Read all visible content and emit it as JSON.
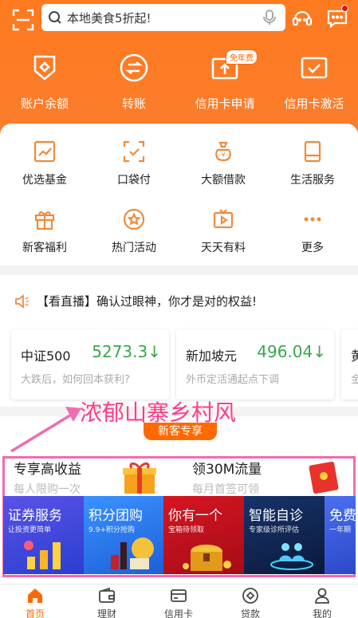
{
  "header": {
    "search_placeholder": "本地美食5折起!",
    "quick_actions": [
      {
        "label": "账户余额",
        "icon": "wallet-shield-icon"
      },
      {
        "label": "转账",
        "icon": "transfer-icon"
      },
      {
        "label": "信用卡申请",
        "icon": "credit-card-apply-icon",
        "badge": "免年费"
      },
      {
        "label": "信用卡激活",
        "icon": "credit-card-activate-icon"
      }
    ]
  },
  "services": [
    {
      "label": "优选基金",
      "icon": "fund-chart-icon"
    },
    {
      "label": "口袋付",
      "icon": "scan-pay-icon"
    },
    {
      "label": "大额借款",
      "icon": "money-bag-icon"
    },
    {
      "label": "生活服务",
      "icon": "tablet-icon"
    },
    {
      "label": "新客福利",
      "icon": "gift-icon"
    },
    {
      "label": "热门活动",
      "icon": "star-badge-icon"
    },
    {
      "label": "天天有料",
      "icon": "video-play-icon"
    },
    {
      "label": "更多",
      "icon": "more-dots-icon"
    }
  ],
  "news": {
    "headline": "【看直播】确认过眼神，你才是对的权益!"
  },
  "market_cards": [
    {
      "name": "中证500",
      "value": "5273.3↓",
      "sub": "大跌后，如何回本获利?"
    },
    {
      "name": "新加坡元",
      "value": "496.04↓",
      "sub": "外币定活通起点下调"
    },
    {
      "name": "黄",
      "value": "",
      "sub": "金"
    }
  ],
  "annotation": "浓郁山寨乡村风",
  "promo": {
    "tag": "新客专享",
    "left_title": "专享高收益",
    "left_sub": "每人限购一次",
    "right_title": "领30M流量",
    "right_sub": "每月首签可领"
  },
  "tiles": [
    {
      "title": "证券服务",
      "sub": "让投资更简单",
      "color": "#3f4fe0"
    },
    {
      "title": "积分团购",
      "sub": "9.9+积分抢购",
      "color": "#2f7df0"
    },
    {
      "title": "你有一个",
      "sub": "宝箱待领取",
      "color": "#c8101c"
    },
    {
      "title": "智能自诊",
      "sub": "专家级诊所评估",
      "color": "#102a55"
    },
    {
      "title": "免费",
      "sub": "一年期",
      "color": "#3d5fe6"
    }
  ],
  "tabbar": [
    {
      "label": "首页",
      "icon": "home-icon",
      "active": true
    },
    {
      "label": "理财",
      "icon": "wallet-icon"
    },
    {
      "label": "信用卡",
      "icon": "credit-card-icon"
    },
    {
      "label": "贷款",
      "icon": "loan-coin-icon"
    },
    {
      "label": "我的",
      "icon": "person-icon"
    }
  ],
  "colors": {
    "brand": "#ff7a1f",
    "accent_pink": "#f26bb0",
    "up_green": "#3aa64a"
  }
}
